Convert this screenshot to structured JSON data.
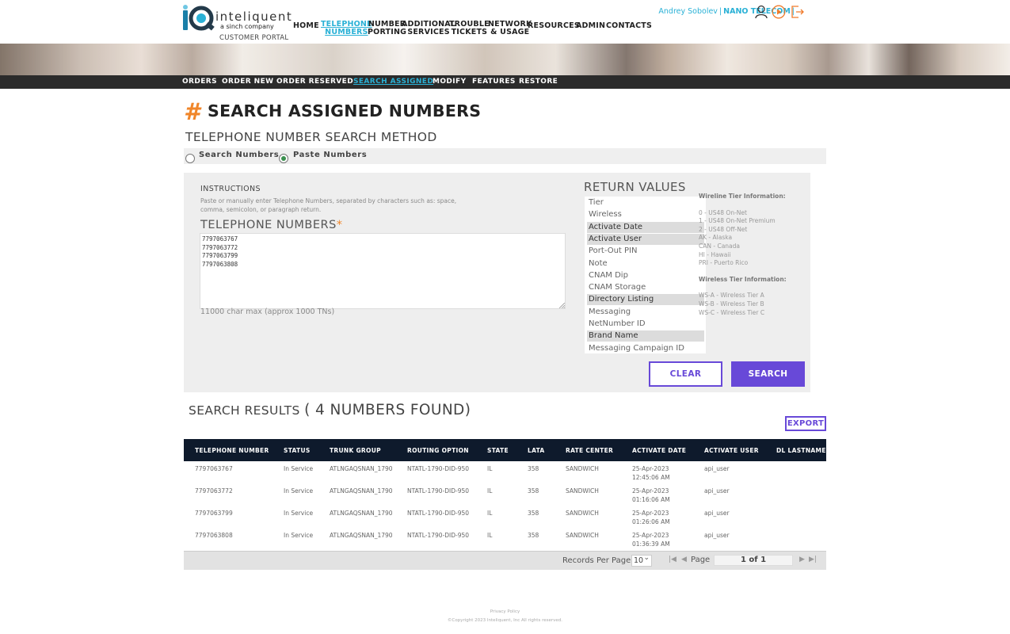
{
  "brand": {
    "name": "inteliquent",
    "tagline": "a sinch company",
    "portal": "CUSTOMER PORTAL",
    "accent_color": "#2ab1d6",
    "primary_button_color": "#6849d8",
    "hash_color": "#f0862a"
  },
  "main_nav": [
    {
      "label": "HOME"
    },
    {
      "label": "TELEPHONE\nNUMBERS"
    },
    {
      "label": "NUMBER\nPORTING"
    },
    {
      "label": "ADDITIONAL\nSERVICES"
    },
    {
      "label": "TROUBLE\nTICKETS"
    },
    {
      "label": "NETWORK\n& USAGE"
    },
    {
      "label": "RESOURCES"
    },
    {
      "label": "ADMIN"
    },
    {
      "label": "CONTACTS"
    }
  ],
  "user": {
    "name": "Andrey Sobolev",
    "company": "NANO TELECOM",
    "icons": [
      "user-icon",
      "play-icon",
      "logout-icon"
    ]
  },
  "sub_nav": [
    {
      "label": "ORDERS"
    },
    {
      "label": "ORDER NEW"
    },
    {
      "label": "ORDER RESERVED"
    },
    {
      "label": "SEARCH ASSIGNED"
    },
    {
      "label": "MODIFY"
    },
    {
      "label": "FEATURES"
    },
    {
      "label": "RESTORE"
    }
  ],
  "page": {
    "hash": "#",
    "title": "SEARCH ASSIGNED NUMBERS",
    "method_title": "TELEPHONE NUMBER SEARCH METHOD",
    "radio_search": "Search Numbers",
    "radio_paste": "Paste Numbers",
    "selected_method": "Paste Numbers"
  },
  "form": {
    "instructions_heading": "INSTRUCTIONS",
    "instructions_text": "Paste or manually enter Telephone Numbers, separated by characters such as: space, comma, semicolon, or paragraph return.",
    "tn_label": "TELEPHONE NUMBERS",
    "required_mark": "*",
    "tn_values": [
      "7797063767",
      "7797063772",
      "7797063799",
      "7797063808"
    ],
    "tn_max": "11000 char max (approx 1000 TNs)",
    "return_values_title": "RETURN VALUES",
    "return_values": [
      {
        "label": "Tier",
        "selected": false
      },
      {
        "label": "Wireless",
        "selected": false
      },
      {
        "label": "Activate Date",
        "selected": true
      },
      {
        "label": "Activate User",
        "selected": true
      },
      {
        "label": "Port-Out PIN",
        "selected": false
      },
      {
        "label": "Note",
        "selected": false
      },
      {
        "label": "CNAM Dip",
        "selected": false
      },
      {
        "label": "CNAM Storage",
        "selected": false
      },
      {
        "label": "Directory Listing",
        "selected": true
      },
      {
        "label": "Messaging",
        "selected": false
      },
      {
        "label": "NetNumber ID",
        "selected": false
      },
      {
        "label": "Brand Name",
        "selected": true
      },
      {
        "label": "Messaging Campaign ID",
        "selected": false
      }
    ],
    "wireline_heading": "Wireline Tier Information:",
    "wireline_tiers": [
      "0 - US48 On-Net",
      "1 - US48 On-Net Premium",
      "2 - US48 Off-Net",
      "AK - Alaska",
      "CAN - Canada",
      "HI - Hawaii",
      "PRI - Puerto Rico"
    ],
    "wireless_heading": "Wireless Tier Information:",
    "wireless_tiers": [
      "WS-A - Wireless Tier A",
      "WS-B - Wireless Tier B",
      "WS-C - Wireless Tier C"
    ],
    "clear_label": "CLEAR",
    "search_label": "SEARCH"
  },
  "results": {
    "title": "SEARCH RESULTS",
    "count_text": "( 4 NUMBERS FOUND)",
    "export_label": "EXPORT",
    "columns": [
      "TELEPHONE NUMBER",
      "STATUS",
      "TRUNK GROUP",
      "ROUTING OPTION",
      "STATE",
      "LATA",
      "RATE CENTER",
      "ACTIVATE DATE",
      "ACTIVATE USER",
      "DL LASTNAME"
    ],
    "rows": [
      {
        "tn": "7797063767",
        "status": "In Service",
        "trunk": "ATLNGAQSNAN_1790",
        "routing": "NTATL-1790-DID-950",
        "state": "IL",
        "lata": "358",
        "rate_center": "SANDWICH",
        "date": "25-Apr-2023",
        "time": "12:45:06 AM",
        "user": "api_user",
        "dl_lastname": ""
      },
      {
        "tn": "7797063772",
        "status": "In Service",
        "trunk": "ATLNGAQSNAN_1790",
        "routing": "NTATL-1790-DID-950",
        "state": "IL",
        "lata": "358",
        "rate_center": "SANDWICH",
        "date": "25-Apr-2023",
        "time": "01:16:06 AM",
        "user": "api_user",
        "dl_lastname": ""
      },
      {
        "tn": "7797063799",
        "status": "In Service",
        "trunk": "ATLNGAQSNAN_1790",
        "routing": "NTATL-1790-DID-950",
        "state": "IL",
        "lata": "358",
        "rate_center": "SANDWICH",
        "date": "25-Apr-2023",
        "time": "01:26:06 AM",
        "user": "api_user",
        "dl_lastname": ""
      },
      {
        "tn": "7797063808",
        "status": "In Service",
        "trunk": "ATLNGAQSNAN_1790",
        "routing": "NTATL-1790-DID-950",
        "state": "IL",
        "lata": "358",
        "rate_center": "SANDWICH",
        "date": "25-Apr-2023",
        "time": "01:36:39 AM",
        "user": "api_user",
        "dl_lastname": ""
      }
    ]
  },
  "pager": {
    "records_label": "Records Per Page",
    "per_page": "10",
    "page_label": "Page",
    "page_value": "1 of 1"
  },
  "footer": {
    "privacy": "Privacy Policy",
    "copyright": "©Copyright 2023 Inteliquent, Inc All rights reserved."
  }
}
